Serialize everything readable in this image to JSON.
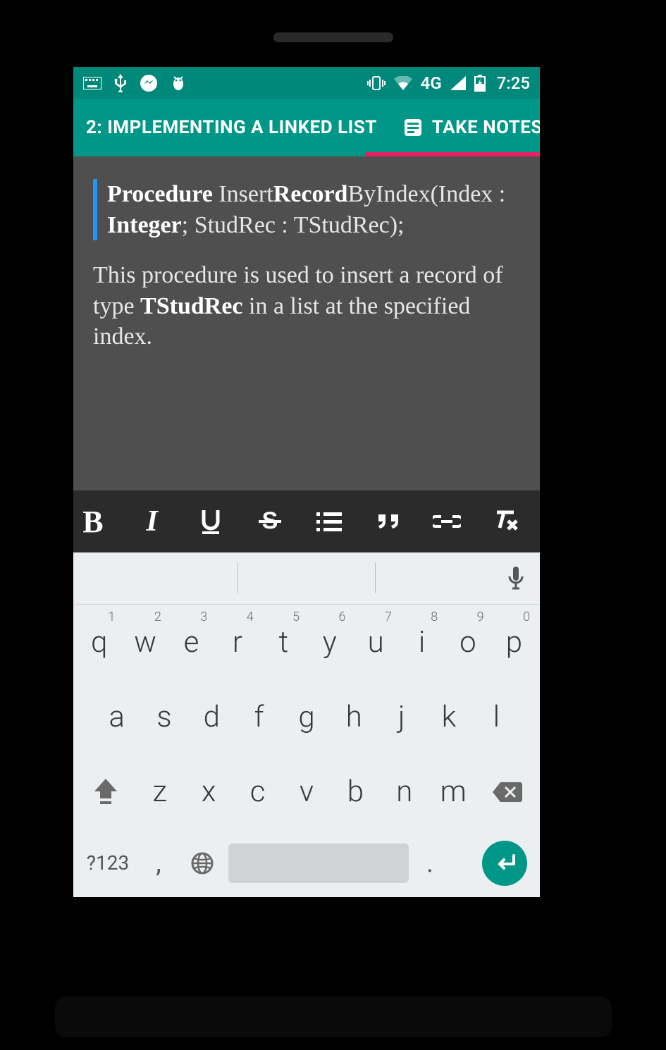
{
  "status_bar": {
    "network_label": "4G",
    "time": "7:25"
  },
  "tabs": {
    "left_label": "2: IMPLEMENTING A LINKED LIST",
    "right_label": "TAKE NOTES"
  },
  "content": {
    "proc_b1": "Procedure",
    "proc_t1": " Insert",
    "proc_b2": "Record",
    "proc_t2": "ByIndex(Index : ",
    "proc_b3": "Integer",
    "proc_t3": "; StudRec : TStudRec);",
    "body_t1": "This procedure is used to insert a record of type ",
    "body_b1": "TStudRec",
    "body_t2": " in a list at the specified index."
  },
  "keyboard": {
    "row1": [
      {
        "c": "q",
        "d": "1"
      },
      {
        "c": "w",
        "d": "2"
      },
      {
        "c": "e",
        "d": "3"
      },
      {
        "c": "r",
        "d": "4"
      },
      {
        "c": "t",
        "d": "5"
      },
      {
        "c": "y",
        "d": "6"
      },
      {
        "c": "u",
        "d": "7"
      },
      {
        "c": "i",
        "d": "8"
      },
      {
        "c": "o",
        "d": "9"
      },
      {
        "c": "p",
        "d": "0"
      }
    ],
    "row2": [
      "a",
      "s",
      "d",
      "f",
      "g",
      "h",
      "j",
      "k",
      "l"
    ],
    "row3": [
      "z",
      "x",
      "c",
      "v",
      "b",
      "n",
      "m"
    ],
    "sym_label": "?123",
    "comma": ",",
    "period": "."
  }
}
